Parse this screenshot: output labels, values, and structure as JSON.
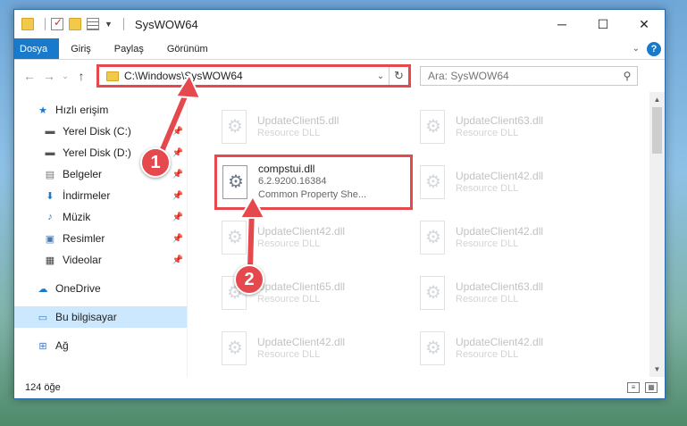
{
  "window": {
    "title": "SysWOW64",
    "controls": {
      "minimize": "─",
      "maximize": "☐",
      "close": "✕"
    }
  },
  "ribbon": {
    "tabs": [
      "Dosya",
      "Giriş",
      "Paylaş",
      "Görünüm"
    ],
    "help": "?"
  },
  "address": {
    "path": "C:\\Windows\\SysWOW64",
    "search_placeholder": "Ara: SysWOW64"
  },
  "nav": {
    "quick_access": "Hızlı erişim",
    "pinned": [
      "Yerel Disk (C:)",
      "Yerel Disk (D:)",
      "Belgeler",
      "İndirmeler",
      "Müzik",
      "Resimler",
      "Videolar"
    ],
    "onedrive": "OneDrive",
    "this_pc": "Bu bilgisayar",
    "network": "Ağ"
  },
  "files": [
    {
      "name": "UpdateClient5.dll",
      "type": "Resource DLL"
    },
    {
      "name": "UpdateClient63.dll",
      "type": "Resource DLL"
    },
    {
      "name": "compstui.dll",
      "version": "6.2.9200.16384",
      "desc": "Common Property She..."
    },
    {
      "name": "UpdateClient42.dll",
      "type": "Resource DLL"
    },
    {
      "name": "UpdateClient42.dll",
      "type": "Resource DLL"
    },
    {
      "name": "UpdateClient42.dll",
      "type": "Resource DLL"
    },
    {
      "name": "UpdateClient65.dll",
      "type": "Resource DLL"
    },
    {
      "name": "UpdateClient63.dll",
      "type": "Resource DLL"
    },
    {
      "name": "UpdateClient42.dll",
      "type": "Resource DLL"
    },
    {
      "name": "UpdateClient42.dll",
      "type": "Resource DLL"
    }
  ],
  "status": {
    "count": "124 öğe"
  },
  "annotations": {
    "step1": "1",
    "step2": "2"
  },
  "colors": {
    "accent": "#1979ca",
    "highlight": "#e5484d",
    "selected": "#cce8ff"
  }
}
